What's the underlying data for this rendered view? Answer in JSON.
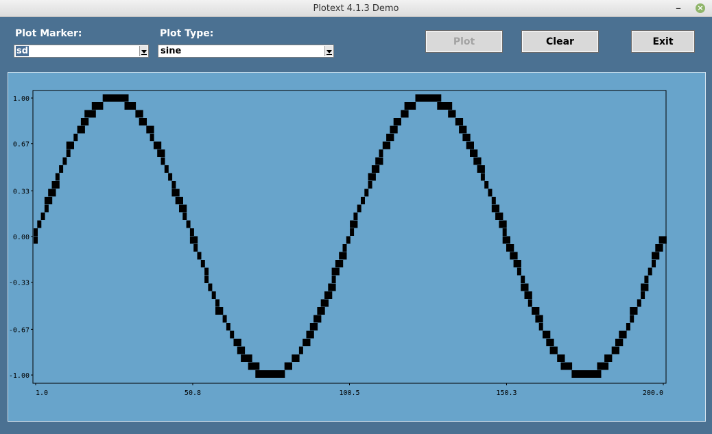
{
  "window": {
    "title": "Plotext 4.1.3 Demo",
    "minimize_glyph": "–",
    "close_glyph": "×"
  },
  "controls": {
    "marker_label": "Plot Marker:",
    "marker_value": "sd",
    "type_label": "Plot Type:",
    "type_value": "sine"
  },
  "buttons": {
    "plot": "Plot",
    "clear": "Clear",
    "exit": "Exit"
  },
  "chart_data": {
    "type": "scatter",
    "marker": "sd",
    "series_color": "#000000",
    "x_range": [
      1.0,
      200.0
    ],
    "y_range": [
      -1.0,
      1.0
    ],
    "periods": 2,
    "points": 100,
    "function": "sine",
    "x_ticks": [
      "1.0",
      "50.8",
      "100.5",
      "150.3",
      "200.0"
    ],
    "x_tick_values": [
      1.0,
      50.8,
      100.5,
      150.3,
      200.0
    ],
    "y_ticks": [
      "1.00",
      "0.67",
      "0.33",
      "0.00",
      "-0.33",
      "-0.67",
      "-1.00"
    ],
    "y_tick_values": [
      1.0,
      0.67,
      0.33,
      0.0,
      -0.33,
      -0.67,
      -1.0
    ],
    "background": "#68a4cb"
  }
}
